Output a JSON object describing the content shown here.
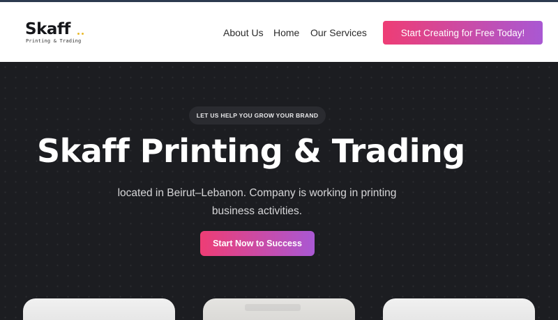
{
  "brand": {
    "logo_text": "Skaff",
    "logo_subtitle": "Printing & Trading",
    "accent_dot_color": "#e9b92a"
  },
  "nav": {
    "items": [
      {
        "label": "About Us"
      },
      {
        "label": "Home"
      },
      {
        "label": "Our Services"
      }
    ],
    "cta_label": "Start Creating for Free Today!"
  },
  "hero": {
    "tagline": "LET US HELP YOU GROW YOUR BRAND",
    "title": "Skaff Printing & Trading",
    "description": "located in Beirut–Lebanon. Company is working in printing business activities.",
    "cta_label": "Start Now to Success"
  },
  "colors": {
    "gradient_start": "#ee3d75",
    "gradient_end": "#a958d3",
    "hero_background": "#1c1d21"
  }
}
